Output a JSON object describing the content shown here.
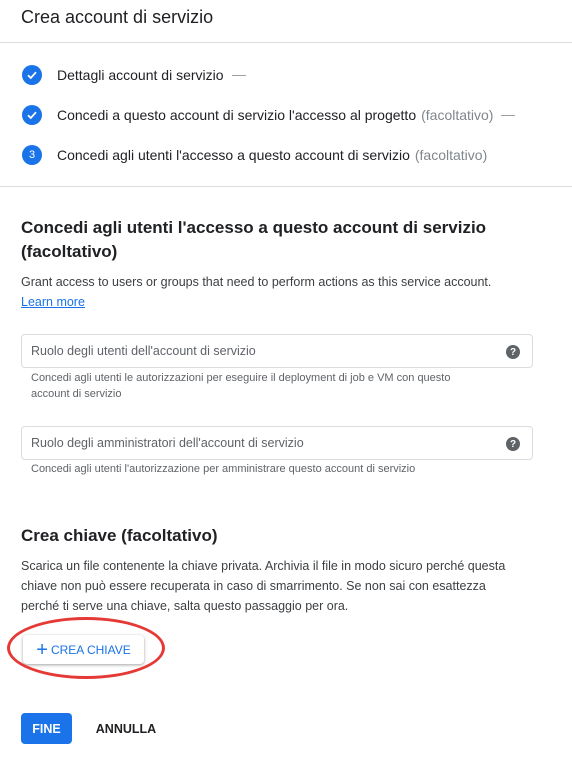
{
  "header": {
    "title": "Crea account di servizio"
  },
  "steps": [
    {
      "index": "1",
      "label": "Dettagli account di servizio",
      "optional": "",
      "state": "done"
    },
    {
      "index": "2",
      "label": "Concedi a questo account di servizio l'accesso al progetto",
      "optional": "(facoltativo)",
      "state": "done"
    },
    {
      "index": "3",
      "label": "Concedi agli utenti l'accesso a questo account di servizio",
      "optional": "(facoltativo)",
      "state": "current"
    }
  ],
  "access_section": {
    "title_line1": "Concedi agli utenti l'accesso a questo account di servizio",
    "title_line2": "(facoltativo)",
    "description": "Grant access to users or groups that need to perform actions as this service account.",
    "learn_more": "Learn more",
    "user_role_field": {
      "placeholder": "Ruolo degli utenti dell'account di servizio",
      "hint_line1": "Concedi agli utenti le autorizzazioni per eseguire il deployment di job e VM con questo",
      "hint_line2": "account di servizio"
    },
    "admin_role_field": {
      "placeholder": "Ruolo degli amministratori dell'account di servizio",
      "hint": "Concedi agli utenti l'autorizzazione per amministrare questo account di servizio"
    }
  },
  "key_section": {
    "title": "Crea chiave (facoltativo)",
    "description_line1": "Scarica un file contenente la chiave privata. Archivia il file in modo sicuro perché questa",
    "description_line2": "chiave non può essere recuperata in caso di smarrimento. Se non sai con esattezza",
    "description_line3": "perché ti serve una chiave, salta questo passaggio per ora.",
    "create_key_label": "CREA CHIAVE"
  },
  "actions": {
    "done_label": "FINE",
    "cancel_label": "ANNULLA"
  },
  "colors": {
    "accent": "#1a73e8",
    "highlight": "#e53935"
  }
}
